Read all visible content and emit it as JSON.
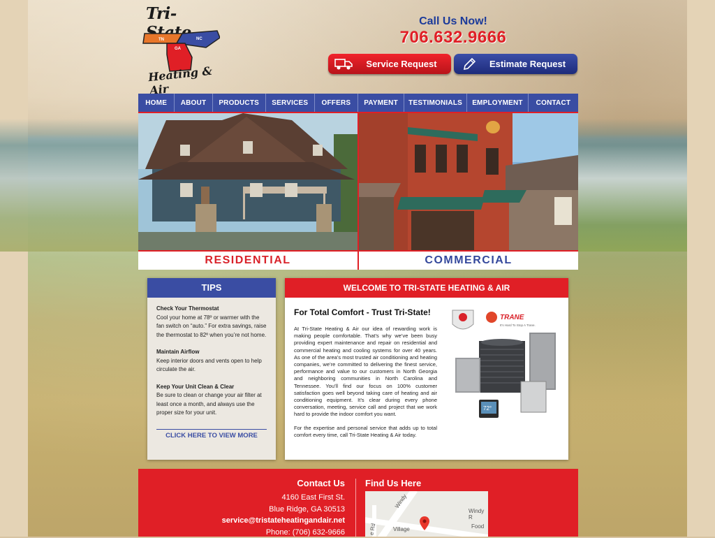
{
  "brand": {
    "line1": "Tri-State",
    "line2": "Heating & Air",
    "states": [
      "TN",
      "NC",
      "GA"
    ]
  },
  "header": {
    "call_label": "Call Us Now!",
    "phone": "706.632.9666",
    "service_request": "Service Request",
    "estimate_request": "Estimate Request"
  },
  "nav": [
    "HOME",
    "ABOUT",
    "PRODUCTS",
    "SERVICES",
    "OFFERS",
    "PAYMENT",
    "TESTIMONIALS",
    "EMPLOYMENT",
    "CONTACT"
  ],
  "hero": {
    "left": "RESIDENTIAL",
    "right": "COMMERCIAL"
  },
  "tips": {
    "title": "TIPS",
    "items": [
      {
        "heading": "Check Your Thermostat",
        "text": "Cool your home at 78º or warmer with the fan switch on “auto.” For extra savings, raise the thermostat to 82º when you’re not home."
      },
      {
        "heading": "Maintain Airflow",
        "text": "Keep interior doors and vents open to help circulate the air."
      },
      {
        "heading": "Keep Your Unit Clean & Clear",
        "text": "Be sure to clean or change your air filter at least once a month, and always use the proper size for your unit."
      }
    ],
    "more": "CLICK HERE TO VIEW MORE"
  },
  "welcome": {
    "title": "WELCOME TO TRI-STATE HEATING & AIR",
    "subtitle": "For Total Comfort - Trust Tri-State!",
    "p1": "At Tri-State Heating & Air our idea of rewarding work is making people comfortable. That’s why we’ve been busy providing expert maintenance and repair on residential and commercial heating and cooling systems for over 40 years. As one of the area’s most trusted air conditioning and heating companies, we’re committed to delivering the finest service, performance and value to our customers in North Georgia and neighboring communities in North Carolina and Tennessee. You’ll find our focus on 100% customer satisfaction goes well beyond taking care of heating and air conditioning equipment. It’s clear during every phone conversation, meeting, service call and project that we work hard to provide the indoor comfort you want.",
    "p2": "For the expertise and personal service that adds up to total comfort every time, call Tri-State Heating & Air today.",
    "trane": "TRANE",
    "trane_tag": "It's Hard To Stop A Trane.",
    "thermostat": "72°"
  },
  "footer": {
    "contact_title": "Contact Us",
    "address1": "4160 East First St.",
    "address2": "Blue Ridge, GA 30513",
    "email": "service@tristateheatingandair.net",
    "phone": "Phone: (706) 632-9666",
    "find_title": "Find Us Here",
    "map_labels": {
      "windy": "Windy",
      "windy_r": "Windy R",
      "food": "Food",
      "village": "Village",
      "ridge": "e Rd"
    }
  },
  "colors": {
    "red": "#e01f26",
    "blue": "#3a4da3"
  }
}
